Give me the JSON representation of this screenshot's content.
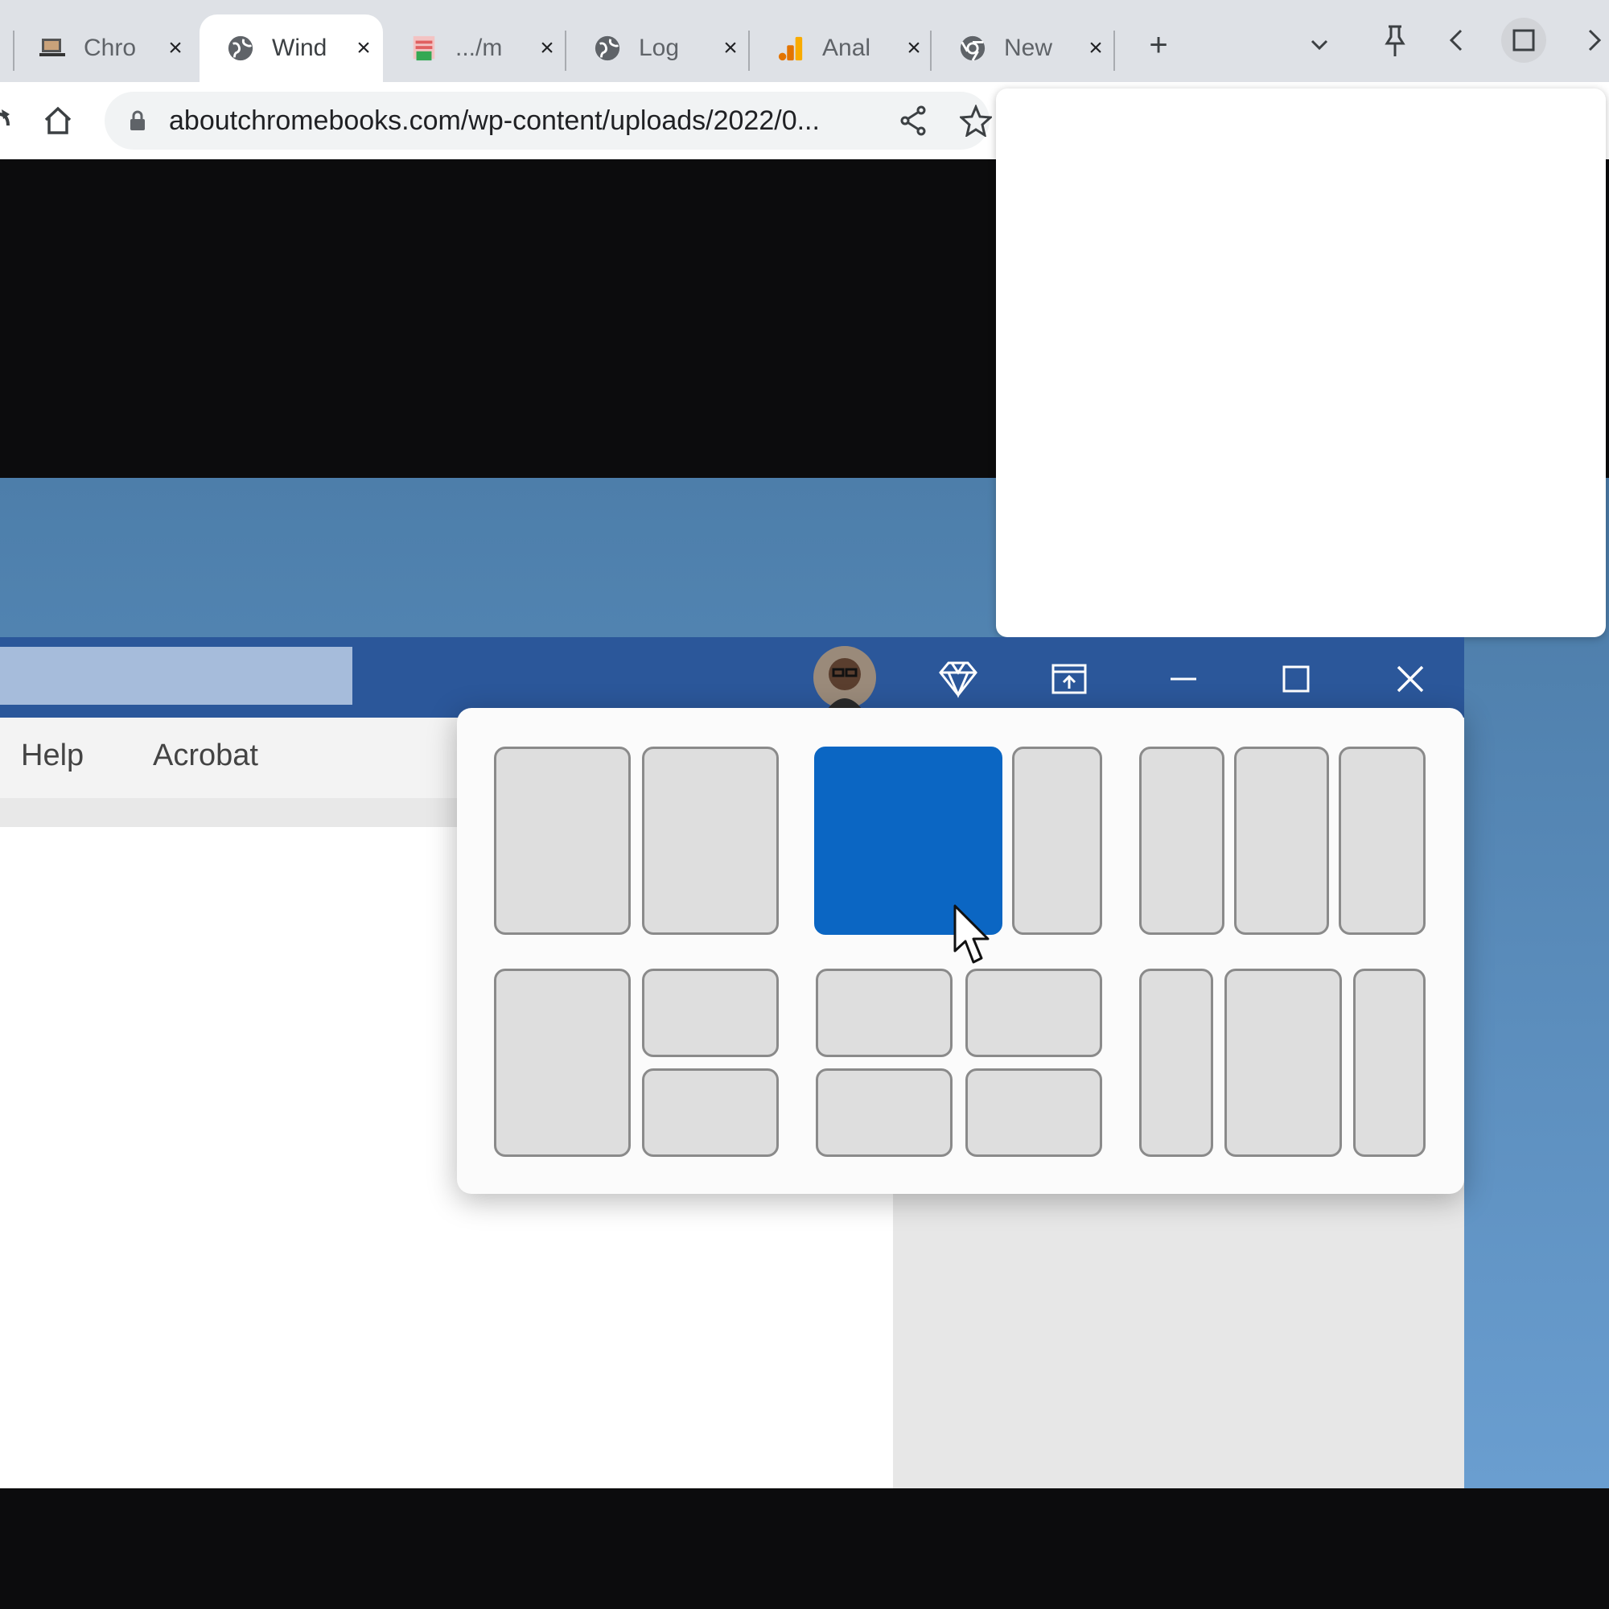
{
  "browser": {
    "tabs": [
      {
        "title": "Chro",
        "icon": "chromebook-favicon-icon",
        "active": false
      },
      {
        "title": "Wind",
        "icon": "globe-icon",
        "active": true
      },
      {
        "title": ".../m",
        "icon": "sheets-favicon-icon",
        "active": false
      },
      {
        "title": "Log",
        "icon": "globe-icon",
        "active": false
      },
      {
        "title": "Anal",
        "icon": "analytics-favicon-icon",
        "active": false
      },
      {
        "title": "New",
        "icon": "chrome-icon",
        "active": false
      }
    ],
    "close_glyph": "×",
    "new_tab_glyph": "+",
    "url": "aboutchromebooks.com/wp-content/uploads/2022/0..."
  },
  "word_window": {
    "menu": [
      "Help",
      "Acrobat"
    ]
  },
  "snap_layouts": {
    "highlighted_layout": 2,
    "highlighted_zone": 1,
    "highlight_color": "#0b66c3"
  },
  "colors": {
    "titlebar": "#2b579a",
    "tabstrip": "#dee1e6",
    "wallpaper": "#5a8fbf"
  }
}
